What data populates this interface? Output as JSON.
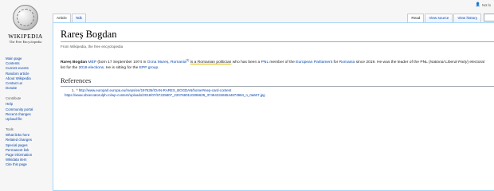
{
  "topbar": {
    "user_label": "Not lo"
  },
  "logo": {
    "wordmark": "WIKIPEDIA",
    "tagline": "The Free Encyclopedia"
  },
  "sidebar": {
    "nav": [
      "Main page",
      "Contents",
      "Current events",
      "Random article",
      "About Wikipedia",
      "Contact us",
      "Donate"
    ],
    "contribute_head": "Contribute",
    "contribute": [
      "Help",
      "Community portal",
      "Recent changes",
      "Upload file"
    ],
    "tools_head": "Tools",
    "tools": [
      "What links here",
      "Related changes",
      "Special pages",
      "Permanent link",
      "Page information",
      "Wikidata item",
      "Cite this page"
    ]
  },
  "tabs": {
    "article": "Article",
    "talk": "Talk",
    "read": "Read",
    "view_source": "View source",
    "view_history": "View history"
  },
  "article": {
    "title": "Rareș Bogdan",
    "site_sub": "From Wikipedia, the free encyclopedia",
    "intro": {
      "name": "Rareș Bogdan",
      "mep": "MEP",
      "born_text": " (born 17 September 1974 in ",
      "birthplace": "Ocna Mureș, Romania",
      "ref": "[1]",
      "highlight": "is a Romanian politician",
      "who_text": " who has been a ",
      "party": "PNL",
      "member_text": " member of the ",
      "parliament": "European Parliament",
      "for_text": " for ",
      "country": "Romania",
      "since_text": " since 2019. He was the leader of the PNL (",
      "party_full": "National Liberal Party",
      "list_text": ") electoral list for the ",
      "elections": "2019 elections",
      "sitting_text": ". He is sitting for the ",
      "group": "EPP group",
      "end": "."
    },
    "refs_heading": "References",
    "refs": [
      {
        "num": "1.",
        "caret": "^",
        "url": "http://www.europarl.europa.eu/meps/en/197636/IOAN-RARES_BOGDAN/home#mep-card-content"
      },
      {
        "url": "https://www.observatorulph.ro/wp-content/uploads/2019/07/67225807_2207690110296639_3749423465544873984_n_0a607.jpg"
      }
    ]
  }
}
